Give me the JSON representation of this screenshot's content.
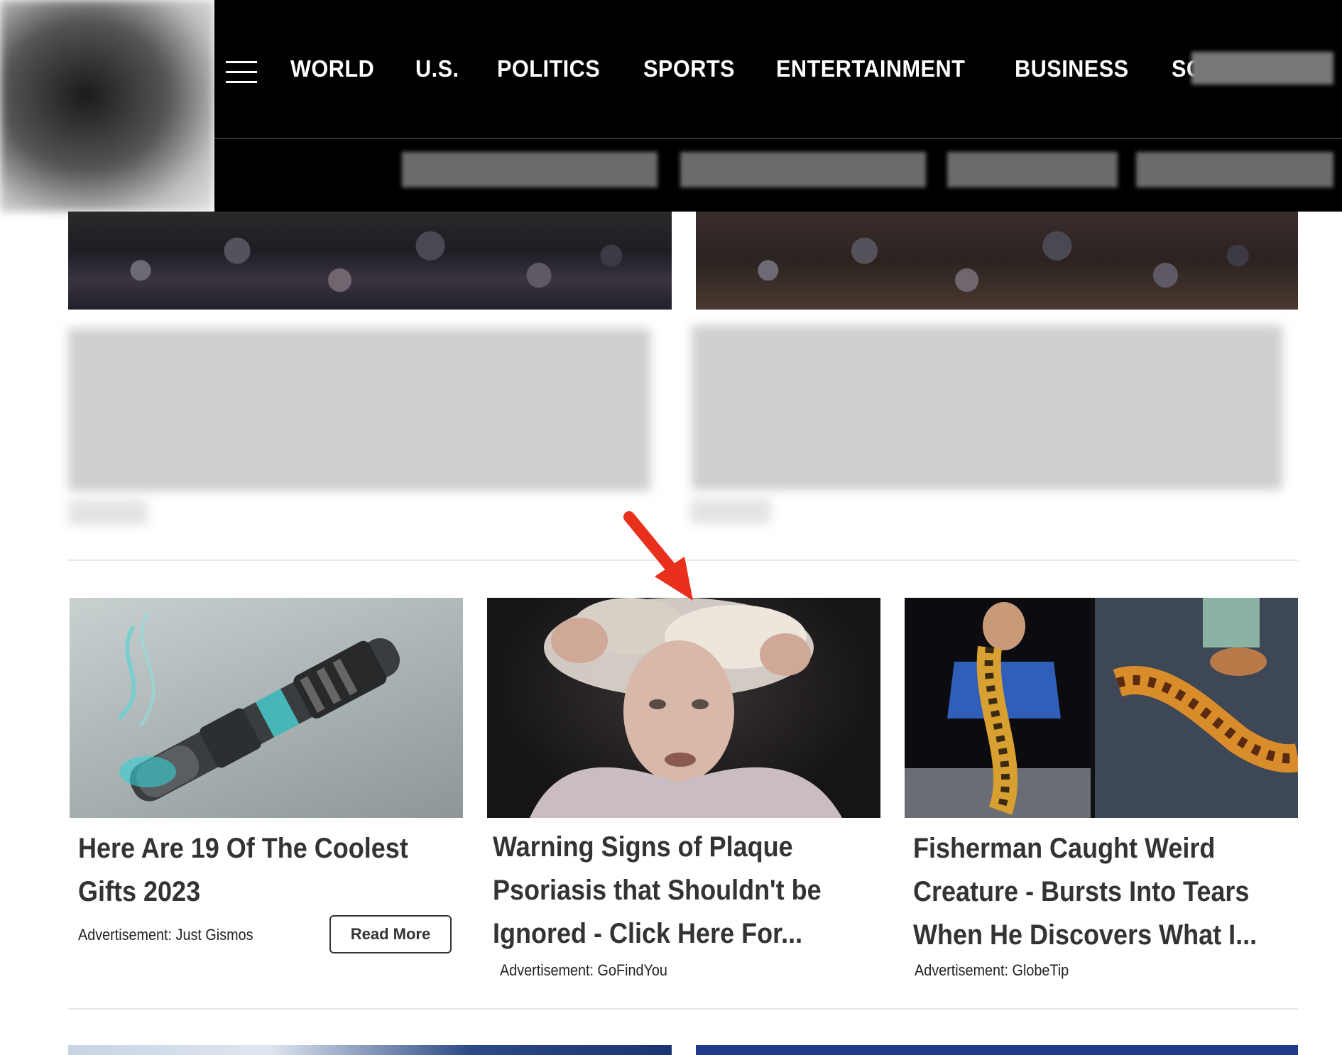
{
  "nav": {
    "links": [
      "WORLD",
      "U.S.",
      "POLITICS",
      "SPORTS",
      "ENTERTAINMENT",
      "BUSINESS",
      "SCIENCE"
    ]
  },
  "ads": [
    {
      "title": "Here Are 19 Of The Coolest Gifts 2023",
      "source": "Advertisement: Just Gismos",
      "button": "Read More"
    },
    {
      "title": "Warning Signs of Plaque Psoriasis that Shouldn't be Ignored - Click Here For...",
      "source": "Advertisement: GoFindYou"
    },
    {
      "title": "Fisherman Caught Weird Creature - Bursts Into Tears When He Discovers What I...",
      "source": "Advertisement: GlobeTip"
    }
  ],
  "colors": {
    "nav_bg": "#000000",
    "annotation_arrow": "#e8301c"
  }
}
